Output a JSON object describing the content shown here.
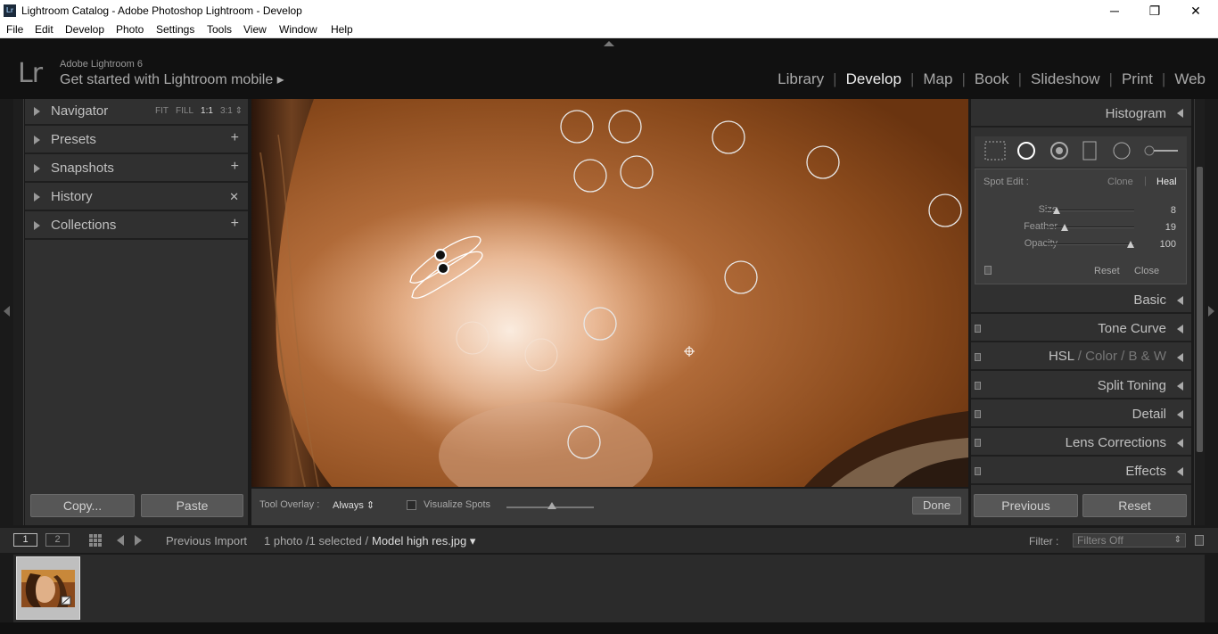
{
  "titlebar": {
    "title": "Lightroom Catalog - Adobe Photoshop Lightroom - Develop",
    "app_icon": "Lr",
    "min": "─",
    "max": "❐",
    "close": "✕"
  },
  "menu": [
    "File",
    "Edit",
    "Develop",
    "Photo",
    "Settings",
    "Tools",
    "View",
    "Window",
    "Help"
  ],
  "identity": {
    "logo": "Lr",
    "version": "Adobe Lightroom 6",
    "mobile": "Get started with Lightroom mobile ▸"
  },
  "modules": {
    "library": "Library",
    "develop": "Develop",
    "map": "Map",
    "book": "Book",
    "slideshow": "Slideshow",
    "print": "Print",
    "web": "Web",
    "sep": "|"
  },
  "left_panel": {
    "navigator": {
      "label": "Navigator",
      "zoom_fit": "FIT",
      "zoom_fill": "FILL",
      "zoom_1": "1:1",
      "zoom_3": "3:1 ⇕"
    },
    "presets": {
      "label": "Presets",
      "action": "+"
    },
    "snapshots": {
      "label": "Snapshots",
      "action": "+"
    },
    "history": {
      "label": "History",
      "action": "✕"
    },
    "collections": {
      "label": "Collections",
      "action": "+"
    },
    "copy": "Copy...",
    "paste": "Paste"
  },
  "toolbar": {
    "overlay_label": "Tool Overlay :",
    "overlay_value": "Always ⇕",
    "visualize": "Visualize Spots",
    "done": "Done"
  },
  "right_panel": {
    "histogram": "Histogram",
    "spot": {
      "label": "Spot Edit :",
      "clone": "Clone",
      "sep": "|",
      "heal": "Heal",
      "size_label": "Size",
      "size": "8",
      "size_frac": 0.13,
      "feather_label": "Feather",
      "feather": "19",
      "feather_frac": 0.22,
      "opacity_label": "Opacity",
      "opacity": "100",
      "opacity_frac": 0.96,
      "reset": "Reset",
      "close": "Close"
    },
    "basic": "Basic",
    "tone": "Tone Curve",
    "hsl": "HSL",
    "hsl_sep": "/",
    "color": "Color",
    "bw": "B & W",
    "split": "Split Toning",
    "detail": "Detail",
    "lens": "Lens Corrections",
    "effects": "Effects",
    "previous": "Previous",
    "reset": "Reset"
  },
  "filmstrip": {
    "view1": "1",
    "view2": "2",
    "source": "Previous Import",
    "count": "1 photo /1 selected /",
    "filename": "Model high res.jpg ▾",
    "filter_label": "Filter :",
    "filter_value": "Filters Off"
  }
}
